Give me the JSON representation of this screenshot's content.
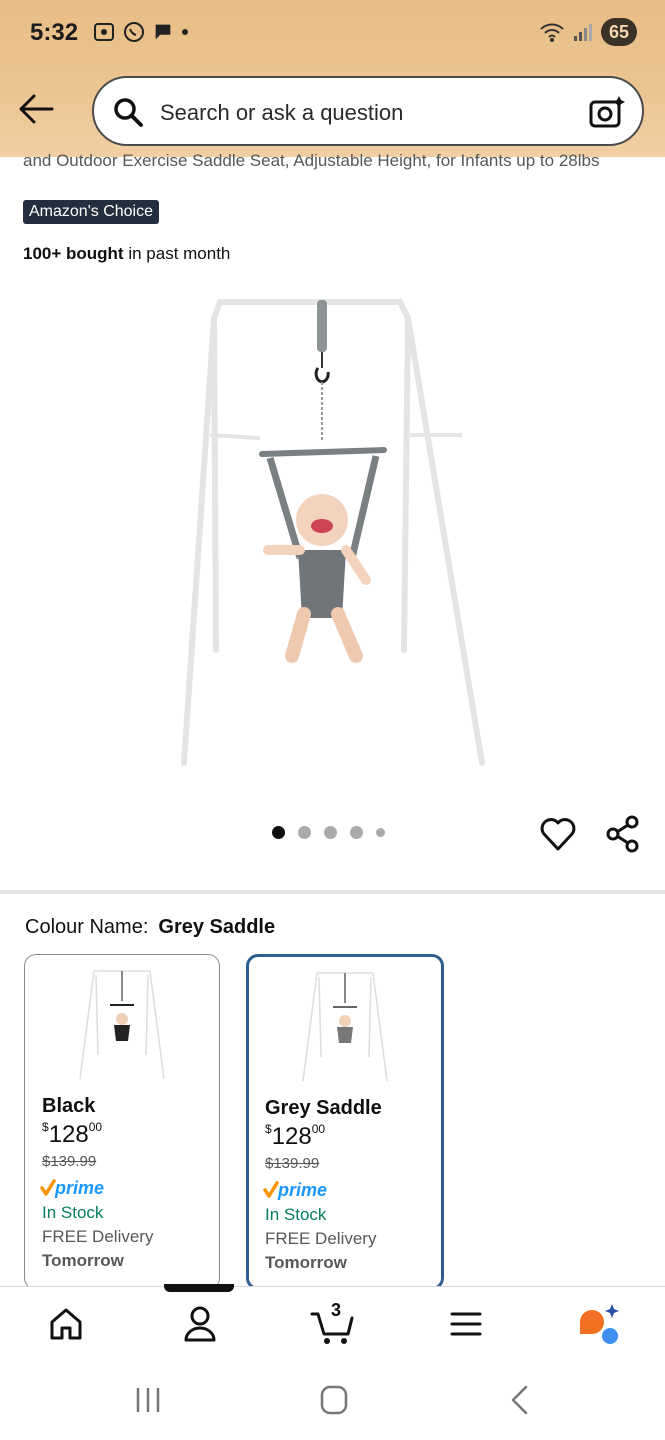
{
  "status_bar": {
    "time": "5:32",
    "battery": "65",
    "left_icons": [
      "screenshot-icon",
      "whatsapp-icon",
      "chat-bubble-icon",
      "dot-icon"
    ],
    "right_icons": [
      "wifi-icon",
      "signal-icon"
    ]
  },
  "search": {
    "placeholder": "Search or ask a question"
  },
  "product": {
    "title_cut": "and Outdoor Exercise Saddle Seat, Adjustable Height, for Infants up to 28lbs",
    "badge": "Amazon's Choice",
    "bought_bold": "100+ bought",
    "bought_rest": " in past month",
    "image_count": 5,
    "active_image": 1
  },
  "colour": {
    "label": "Colour Name:",
    "selected": "Grey Saddle"
  },
  "variants": [
    {
      "name": "Black",
      "price_symbol": "$",
      "price_whole": "128",
      "price_fraction": "00",
      "list_price": "$139.99",
      "prime": "prime",
      "stock": "In Stock",
      "delivery": "FREE Delivery",
      "delivery_day": "Tomorrow",
      "selected": false
    },
    {
      "name": "Grey Saddle",
      "price_symbol": "$",
      "price_whole": "128",
      "price_fraction": "00",
      "list_price": "$139.99",
      "prime": "prime",
      "stock": "In Stock",
      "delivery": "FREE Delivery",
      "delivery_day": "Tomorrow",
      "selected": true
    }
  ],
  "bottom_nav": {
    "cart_count": "3",
    "items": [
      "home-icon",
      "account-icon",
      "cart-icon",
      "menu-icon",
      "rufus-icon"
    ]
  },
  "colors": {
    "header_top": "#e9bd85",
    "selected_border": "#2f5d8f",
    "in_stock": "#067d62",
    "prime_blue": "#1a98ff",
    "prime_check": "#f79400",
    "badge_bg": "#232f3e"
  }
}
